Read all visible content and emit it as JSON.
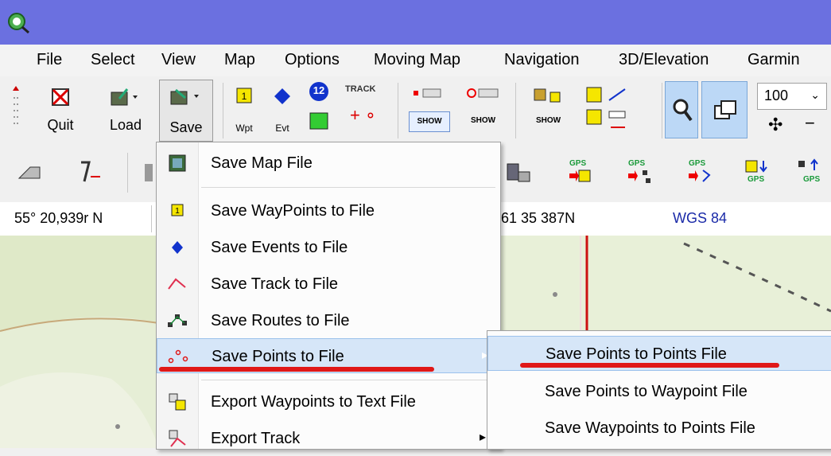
{
  "menubar": {
    "items": [
      "File",
      "Select",
      "View",
      "Map",
      "Options",
      "Moving Map",
      "Navigation",
      "3D/Elevation",
      "Garmin"
    ]
  },
  "toolbar": {
    "quit_label": "Quit",
    "load_label": "Load",
    "save_label": "Save",
    "wpt_label": "Wpt",
    "evt_label": "Evt",
    "badge_number": "12",
    "track_label": "TRACK",
    "show_label": "SHOW",
    "zoom_value": "100"
  },
  "status": {
    "lat": "55° 20,939r N",
    "coord2": "61 35 387N",
    "datum": "WGS 84"
  },
  "save_menu": {
    "items": [
      {
        "label": "Save Map File",
        "icon": "map-file-icon"
      },
      {
        "label": "Save WayPoints to File",
        "icon": "waypoint-icon"
      },
      {
        "label": "Save Events to File",
        "icon": "diamond-icon"
      },
      {
        "label": "Save Track to File",
        "icon": "track-icon"
      },
      {
        "label": "Save Routes to File",
        "icon": "route-icon"
      },
      {
        "label": "Save Points to File",
        "icon": "points-icon",
        "highlighted": true
      },
      {
        "label": "Export Waypoints to Text File",
        "icon": "export-waypoints-icon"
      },
      {
        "label": "Export Track",
        "icon": "export-track-icon"
      }
    ]
  },
  "points_submenu": {
    "items": [
      {
        "label": "Save Points to Points File",
        "highlighted": true
      },
      {
        "label": "Save Points to Waypoint File"
      },
      {
        "label": "Save Waypoints to Points File"
      }
    ]
  },
  "colors": {
    "titlebar": "#6b70e0",
    "highlight": "#d6e6f8",
    "red_underline": "#e01818",
    "map_green": "#dfe9c8",
    "datum_blue": "#1a2aa8"
  }
}
